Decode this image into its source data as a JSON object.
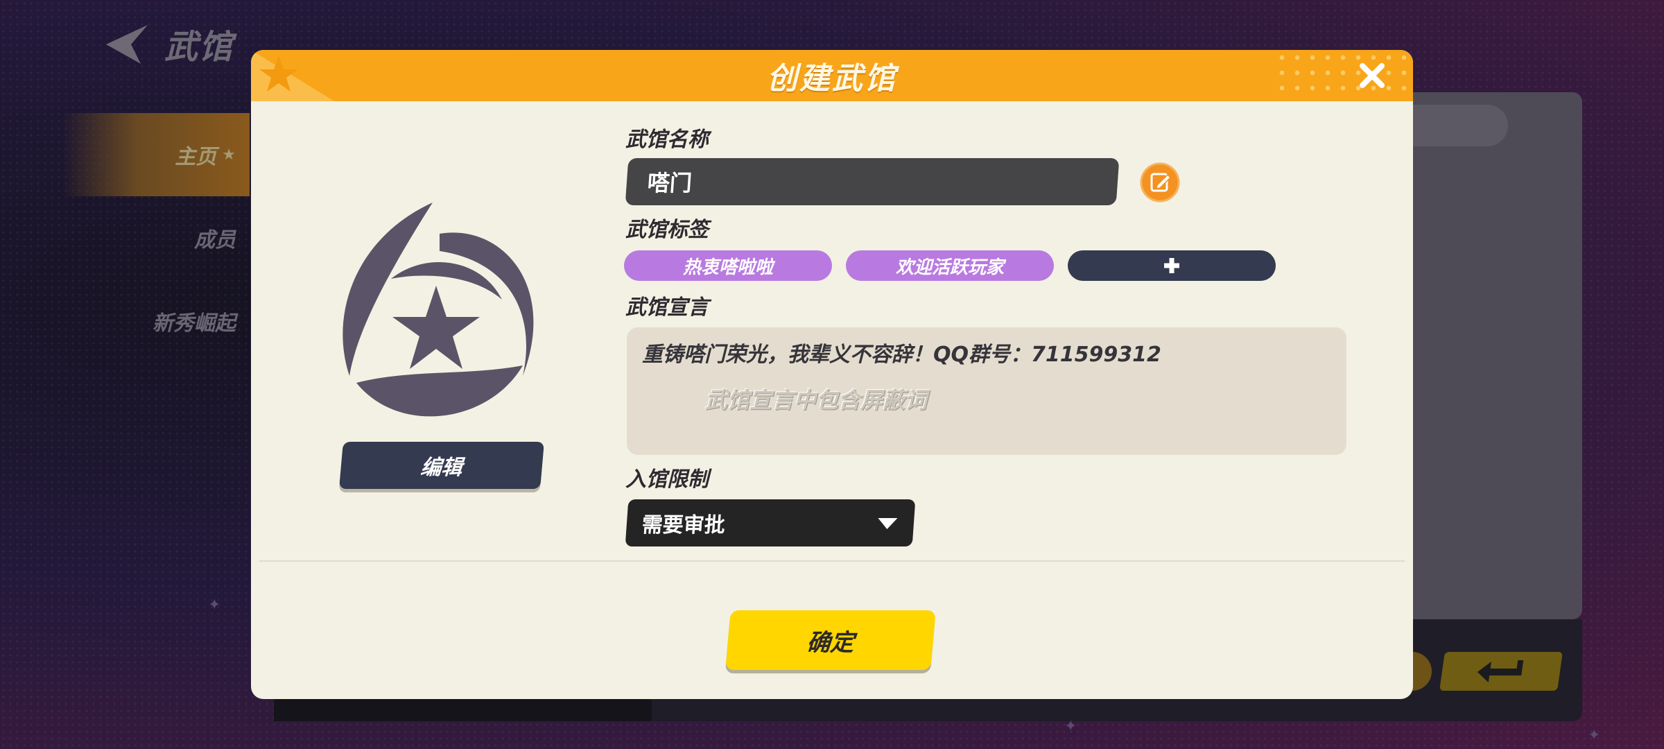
{
  "background": {
    "page_title": "武馆",
    "nav": [
      {
        "label": "主页",
        "active": true,
        "icon": "star-icon"
      },
      {
        "label": "成员",
        "active": false
      },
      {
        "label": "新秀崛起",
        "active": false
      }
    ],
    "return_icon": "return-icon"
  },
  "modal": {
    "title": "创建武馆",
    "close_icon": "close-icon",
    "emblem_icon": "guild-emblem-icon",
    "edit_emblem_label": "编辑",
    "name_label": "武馆名称",
    "name_value": "嗒门",
    "name_edit_icon": "pencil-icon",
    "tags_label": "武馆标签",
    "tags": [
      "热衷嗒啦啦",
      "欢迎活跃玩家"
    ],
    "add_tag_icon": "plus-icon",
    "manifesto_label": "武馆宣言",
    "manifesto_text": "重铸嗒门荣光，我辈义不容辞！QQ群号：711599312",
    "manifesto_warning": "武馆宣言中包含屏蔽词",
    "join_label": "入馆限制",
    "join_value": "需要审批",
    "confirm_label": "确定"
  },
  "colors": {
    "header": "#f8a51a",
    "tag": "#b87ae0",
    "confirm": "#ffd600",
    "dark_button": "#343a4f"
  }
}
